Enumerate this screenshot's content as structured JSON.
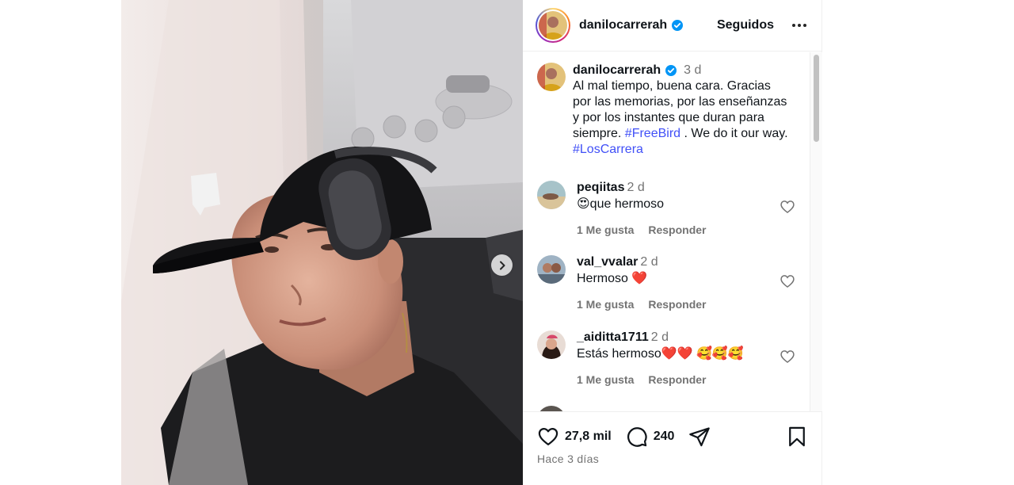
{
  "post": {
    "username": "danilocarrerah",
    "follow_label": "Seguidos",
    "caption": {
      "username": "danilocarrerah",
      "time": "3 d",
      "text_line1": "Al mal tiempo, buena cara. Gracias",
      "text_line2": "por las memorias, por las enseñanzas",
      "text_line3": "y por los instantes que duran para",
      "text_line4a": "siempre. ",
      "hashtag1": "#FreeBird",
      "text_line4b": " . We do it our way.",
      "hashtag2": "#LosCarrera"
    }
  },
  "comments": [
    {
      "username": "peqiitas",
      "time": "2 d",
      "text": "😍que hermoso",
      "likes": "1 Me gusta",
      "reply": "Responder"
    },
    {
      "username": "val_vvalar",
      "time": "2 d",
      "text": "Hermoso ❤️",
      "likes": "1 Me gusta",
      "reply": "Responder"
    },
    {
      "username": "_aiditta1711",
      "time": "2 d",
      "text": "Estás hermoso❤️❤️ 🥰🥰🥰",
      "likes": "1 Me gusta",
      "reply": "Responder"
    }
  ],
  "actions": {
    "likes_count": "27,8 mil",
    "comments_count": "240",
    "posted_ago": "Hace 3 días"
  },
  "icons": {
    "verified": "verified-badge-icon",
    "more": "more-options-icon",
    "next": "chevron-right-icon",
    "like": "heart-icon",
    "comment": "comment-bubble-icon",
    "share": "paper-plane-icon",
    "save": "bookmark-icon"
  },
  "colors": {
    "hashtag": "#4150f7",
    "verified": "#0095f6",
    "heart_emoji": "#e0245e"
  }
}
